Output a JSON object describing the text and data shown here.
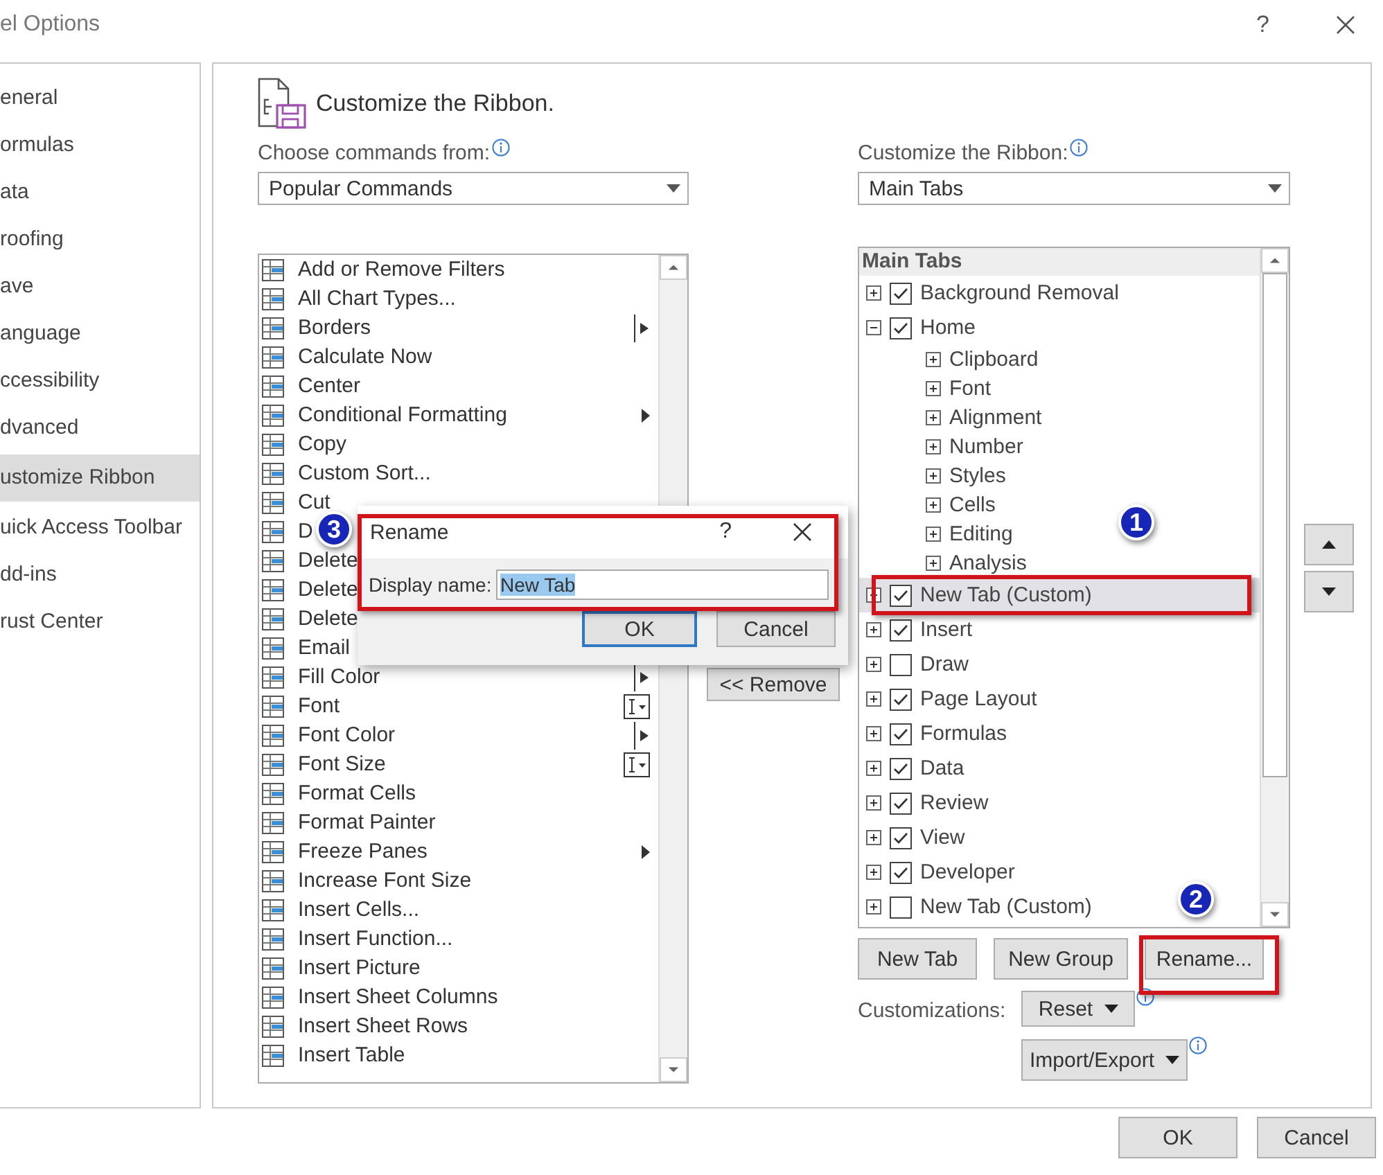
{
  "window": {
    "title": "el Options",
    "help": "?"
  },
  "sidebar": {
    "items": [
      {
        "label": "eneral",
        "selected": false
      },
      {
        "label": "ormulas",
        "selected": false
      },
      {
        "label": "ata",
        "selected": false
      },
      {
        "label": "roofing",
        "selected": false
      },
      {
        "label": "ave",
        "selected": false
      },
      {
        "label": "anguage",
        "selected": false
      },
      {
        "label": "ccessibility",
        "selected": false
      },
      {
        "label": "dvanced",
        "selected": false
      },
      {
        "label": "ustomize Ribbon",
        "selected": true
      },
      {
        "label": "uick Access Toolbar",
        "selected": false
      },
      {
        "label": "dd-ins",
        "selected": false
      },
      {
        "label": "rust Center",
        "selected": false
      }
    ]
  },
  "section": {
    "title": "Customize the Ribbon."
  },
  "commands": {
    "label": "Choose commands from:",
    "dropdown": "Popular Commands",
    "items": [
      {
        "label": "Add or Remove Filters",
        "kind": "command"
      },
      {
        "label": "All Chart Types...",
        "kind": "command"
      },
      {
        "label": "Borders",
        "kind": "split"
      },
      {
        "label": "Calculate Now",
        "kind": "command"
      },
      {
        "label": "Center",
        "kind": "command"
      },
      {
        "label": "Conditional Formatting",
        "kind": "submenu"
      },
      {
        "label": "Copy",
        "kind": "command"
      },
      {
        "label": "Custom Sort...",
        "kind": "command"
      },
      {
        "label": "Cut",
        "kind": "command"
      },
      {
        "label": "D",
        "kind": "command"
      },
      {
        "label": "Delete",
        "kind": "command"
      },
      {
        "label": "Delete",
        "kind": "command"
      },
      {
        "label": "Delete",
        "kind": "command"
      },
      {
        "label": "Email",
        "kind": "command"
      },
      {
        "label": "Fill Color",
        "kind": "split"
      },
      {
        "label": "Font",
        "kind": "combo"
      },
      {
        "label": "Font Color",
        "kind": "split"
      },
      {
        "label": "Font Size",
        "kind": "combo"
      },
      {
        "label": "Format Cells",
        "kind": "command"
      },
      {
        "label": "Format Painter",
        "kind": "command"
      },
      {
        "label": "Freeze Panes",
        "kind": "submenu"
      },
      {
        "label": "Increase Font Size",
        "kind": "command"
      },
      {
        "label": "Insert Cells...",
        "kind": "command"
      },
      {
        "label": "Insert Function...",
        "kind": "command"
      },
      {
        "label": "Insert Picture",
        "kind": "command"
      },
      {
        "label": "Insert Sheet Columns",
        "kind": "command"
      },
      {
        "label": "Insert Sheet Rows",
        "kind": "command"
      },
      {
        "label": "Insert Table",
        "kind": "command"
      }
    ]
  },
  "middle": {
    "remove_button": "<< Remove"
  },
  "ribbon": {
    "label": "Customize the Ribbon:",
    "dropdown": "Main Tabs",
    "header": "Main Tabs",
    "tree": [
      {
        "label": "Background Removal",
        "checked": true,
        "expanded": false,
        "selected": false
      },
      {
        "label": "Home",
        "checked": true,
        "expanded": true,
        "selected": false,
        "children": [
          {
            "label": "Clipboard",
            "expanded": false
          },
          {
            "label": "Font",
            "expanded": false
          },
          {
            "label": "Alignment",
            "expanded": false
          },
          {
            "label": "Number",
            "expanded": false
          },
          {
            "label": "Styles",
            "expanded": false
          },
          {
            "label": "Cells",
            "expanded": false
          },
          {
            "label": "Editing",
            "expanded": false
          },
          {
            "label": "Analysis",
            "expanded": false
          }
        ]
      },
      {
        "label": "New Tab (Custom)",
        "checked": true,
        "expanded": false,
        "selected": true
      },
      {
        "label": "Insert",
        "checked": true,
        "expanded": false,
        "selected": false
      },
      {
        "label": "Draw",
        "checked": false,
        "expanded": false,
        "selected": false
      },
      {
        "label": "Page Layout",
        "checked": true,
        "expanded": false,
        "selected": false
      },
      {
        "label": "Formulas",
        "checked": true,
        "expanded": false,
        "selected": false
      },
      {
        "label": "Data",
        "checked": true,
        "expanded": false,
        "selected": false
      },
      {
        "label": "Review",
        "checked": true,
        "expanded": false,
        "selected": false
      },
      {
        "label": "View",
        "checked": true,
        "expanded": false,
        "selected": false
      },
      {
        "label": "Developer",
        "checked": true,
        "expanded": false,
        "selected": false
      },
      {
        "label": "New Tab (Custom)",
        "checked": false,
        "expanded": false,
        "selected": false
      }
    ],
    "new_tab": "New Tab",
    "new_group": "New Group",
    "rename": "Rename...",
    "customizations_label": "Customizations:",
    "reset": "Reset",
    "import_export": "Import/Export"
  },
  "footer": {
    "ok": "OK",
    "cancel": "Cancel"
  },
  "rename_dialog": {
    "title": "Rename",
    "help": "?",
    "field_label": "Display name:",
    "value": "New Tab",
    "ok": "OK",
    "cancel": "Cancel"
  },
  "callouts": [
    "1",
    "2",
    "3"
  ]
}
